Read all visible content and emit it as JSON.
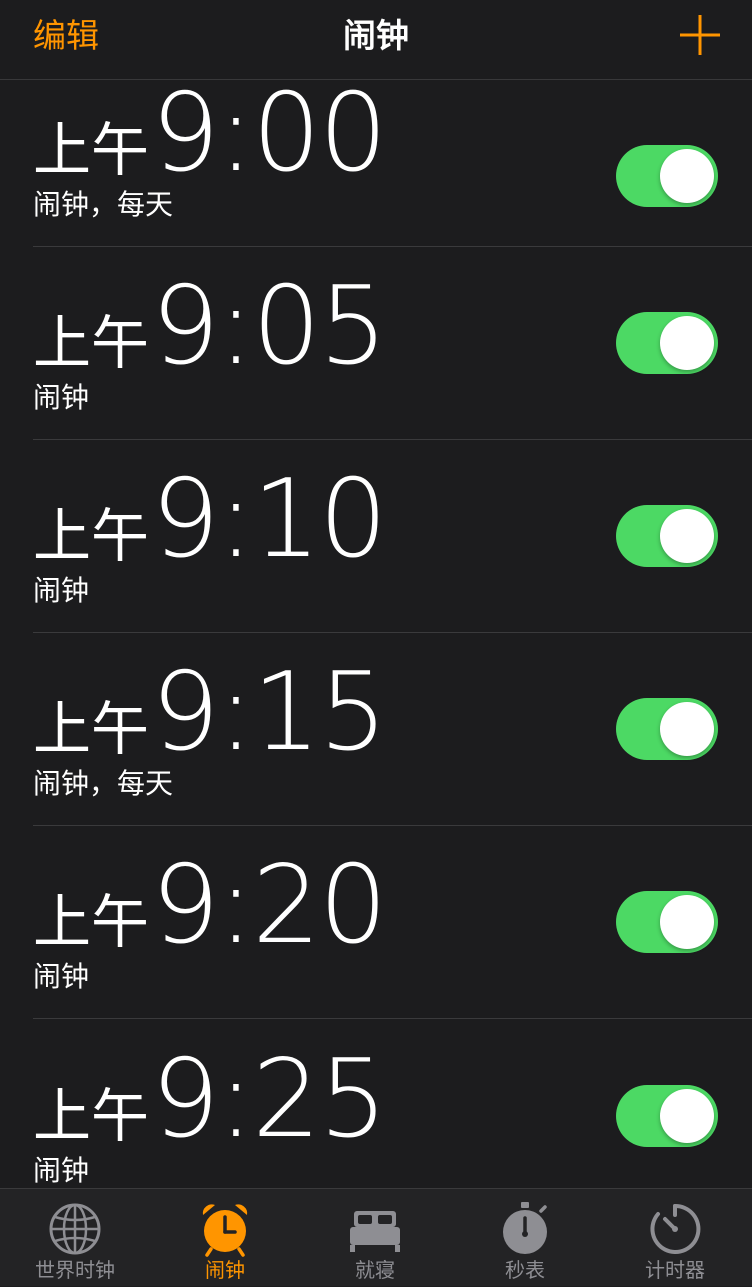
{
  "navbar": {
    "edit_label": "编辑",
    "title": "闹钟",
    "add_icon": "plus-icon"
  },
  "alarms": [
    {
      "ampm": "上午",
      "time": "9:00",
      "label": "闹钟，每天",
      "enabled": true
    },
    {
      "ampm": "上午",
      "time": "9:05",
      "label": "闹钟",
      "enabled": true
    },
    {
      "ampm": "上午",
      "time": "9:10",
      "label": "闹钟",
      "enabled": true
    },
    {
      "ampm": "上午",
      "time": "9:15",
      "label": "闹钟，每天",
      "enabled": true
    },
    {
      "ampm": "上午",
      "time": "9:20",
      "label": "闹钟",
      "enabled": true
    },
    {
      "ampm": "上午",
      "time": "9:25",
      "label": "闹钟",
      "enabled": true
    }
  ],
  "tabbar": {
    "tabs": [
      {
        "label": "世界时钟",
        "icon": "globe-icon",
        "active": false
      },
      {
        "label": "闹钟",
        "icon": "alarm-clock-icon",
        "active": true
      },
      {
        "label": "就寝",
        "icon": "bed-icon",
        "active": false
      },
      {
        "label": "秒表",
        "icon": "stopwatch-icon",
        "active": false
      },
      {
        "label": "计时器",
        "icon": "timer-icon",
        "active": false
      }
    ]
  },
  "colors": {
    "accent": "#ff9500",
    "toggle_on": "#4cd964",
    "background": "#1c1c1e",
    "inactive_tab": "#8e8e93"
  }
}
